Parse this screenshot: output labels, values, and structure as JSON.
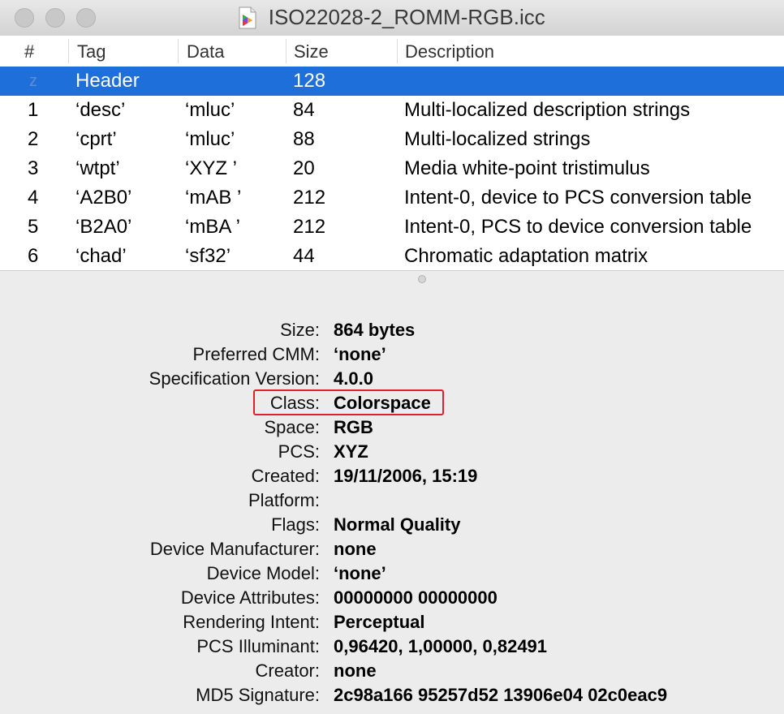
{
  "window": {
    "title": "ISO22028-2_ROMM-RGB.icc",
    "controls": [
      "close",
      "minimize",
      "zoom"
    ]
  },
  "table": {
    "columns": [
      "#",
      "Tag",
      "Data",
      "Size",
      "Description"
    ],
    "rows": [
      {
        "num": "z",
        "tag": "Header",
        "data": "",
        "size": "128",
        "description": "",
        "selected": true
      },
      {
        "num": "1",
        "tag": "‘desc’",
        "data": "‘mluc’",
        "size": "84",
        "description": "Multi-localized description strings"
      },
      {
        "num": "2",
        "tag": "‘cprt’",
        "data": "‘mluc’",
        "size": "88",
        "description": "Multi-localized strings"
      },
      {
        "num": "3",
        "tag": "‘wtpt’",
        "data": "‘XYZ ’",
        "size": "20",
        "description": "Media white-point tristimulus"
      },
      {
        "num": "4",
        "tag": "‘A2B0’",
        "data": "‘mAB ’",
        "size": "212",
        "description": "Intent-0, device to PCS conversion table"
      },
      {
        "num": "5",
        "tag": "‘B2A0’",
        "data": "‘mBA ’",
        "size": "212",
        "description": "Intent-0, PCS to device conversion table"
      },
      {
        "num": "6",
        "tag": "‘chad’",
        "data": "‘sf32’",
        "size": "44",
        "description": "Chromatic adaptation matrix"
      }
    ]
  },
  "info": [
    {
      "label": "Size:",
      "value": "864 bytes"
    },
    {
      "label": "Preferred CMM:",
      "value": "‘none’"
    },
    {
      "label": "Specification Version:",
      "value": "4.0.0"
    },
    {
      "label": "Class:",
      "value": "Colorspace",
      "highlighted": true
    },
    {
      "label": "Space:",
      "value": "RGB"
    },
    {
      "label": "PCS:",
      "value": "XYZ"
    },
    {
      "label": "Created:",
      "value": "19/11/2006, 15:19"
    },
    {
      "label": "Platform:",
      "value": ""
    },
    {
      "label": "Flags:",
      "value": "Normal Quality"
    },
    {
      "label": "Device Manufacturer:",
      "value": "none"
    },
    {
      "label": "Device Model:",
      "value": "‘none’"
    },
    {
      "label": "Device Attributes:",
      "value": "00000000 00000000"
    },
    {
      "label": "Rendering Intent:",
      "value": "Perceptual"
    },
    {
      "label": "PCS Illuminant:",
      "value": "0,96420, 1,00000, 0,82491"
    },
    {
      "label": "Creator:",
      "value": "none"
    },
    {
      "label": "MD5 Signature:",
      "value": "2c98a166 95257d52 13906e04 02c0eac9"
    }
  ],
  "colors": {
    "selection": "#1e6fd9",
    "highlight_border": "#e0202a",
    "pane_background": "#ececec"
  },
  "icons": {
    "document": "icc-document-icon"
  }
}
